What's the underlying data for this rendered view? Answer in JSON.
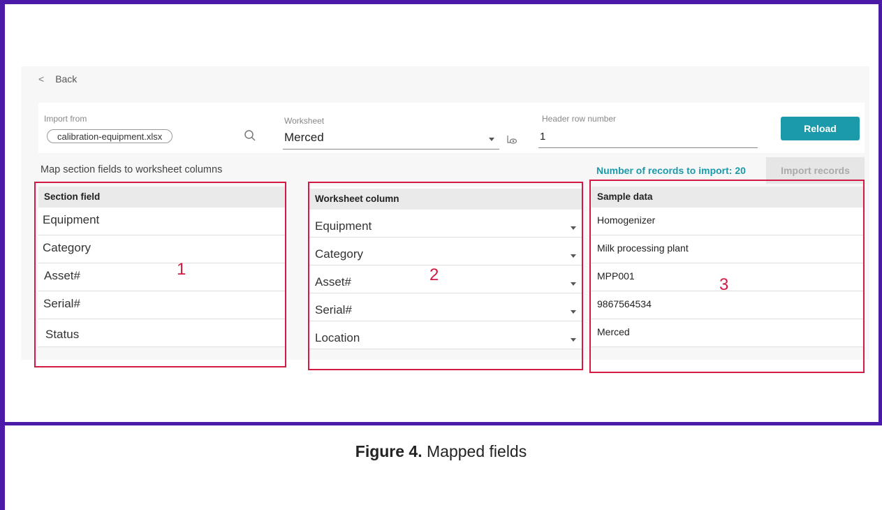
{
  "nav": {
    "back_icon": "<",
    "back_label": "Back"
  },
  "import": {
    "from_label": "Import from",
    "file_name": "calibration-equipment.xlsx",
    "worksheet_label": "Worksheet",
    "worksheet_value": "Merced",
    "header_row_label": "Header row number",
    "header_row_value": "1",
    "reload_label": "Reload"
  },
  "mapping": {
    "title": "Map section fields to worksheet columns",
    "records_text": "Number of records to import: 20",
    "import_button": "Import records",
    "section_header": "Section field",
    "worksheet_header": "Worksheet column",
    "sample_header": "Sample data",
    "rows": [
      {
        "field": "Equipment",
        "column": "Equipment",
        "sample": "Homogenizer"
      },
      {
        "field": "Category",
        "column": "Category",
        "sample": "Milk processing plant"
      },
      {
        "field": "Asset#",
        "column": "Asset#",
        "sample": "MPP001"
      },
      {
        "field": "Serial#",
        "column": "Serial#",
        "sample": "9867564534"
      },
      {
        "field": "Status",
        "column": "Location",
        "sample": "Merced"
      }
    ]
  },
  "annotations": {
    "box1": "1",
    "box2": "2",
    "box3": "3"
  },
  "caption": {
    "bold": "Figure 4.",
    "text": " Mapped fields"
  },
  "colors": {
    "accent": "#1a9aaa",
    "annotation": "#d11b45",
    "frame": "#4b1aa8"
  }
}
